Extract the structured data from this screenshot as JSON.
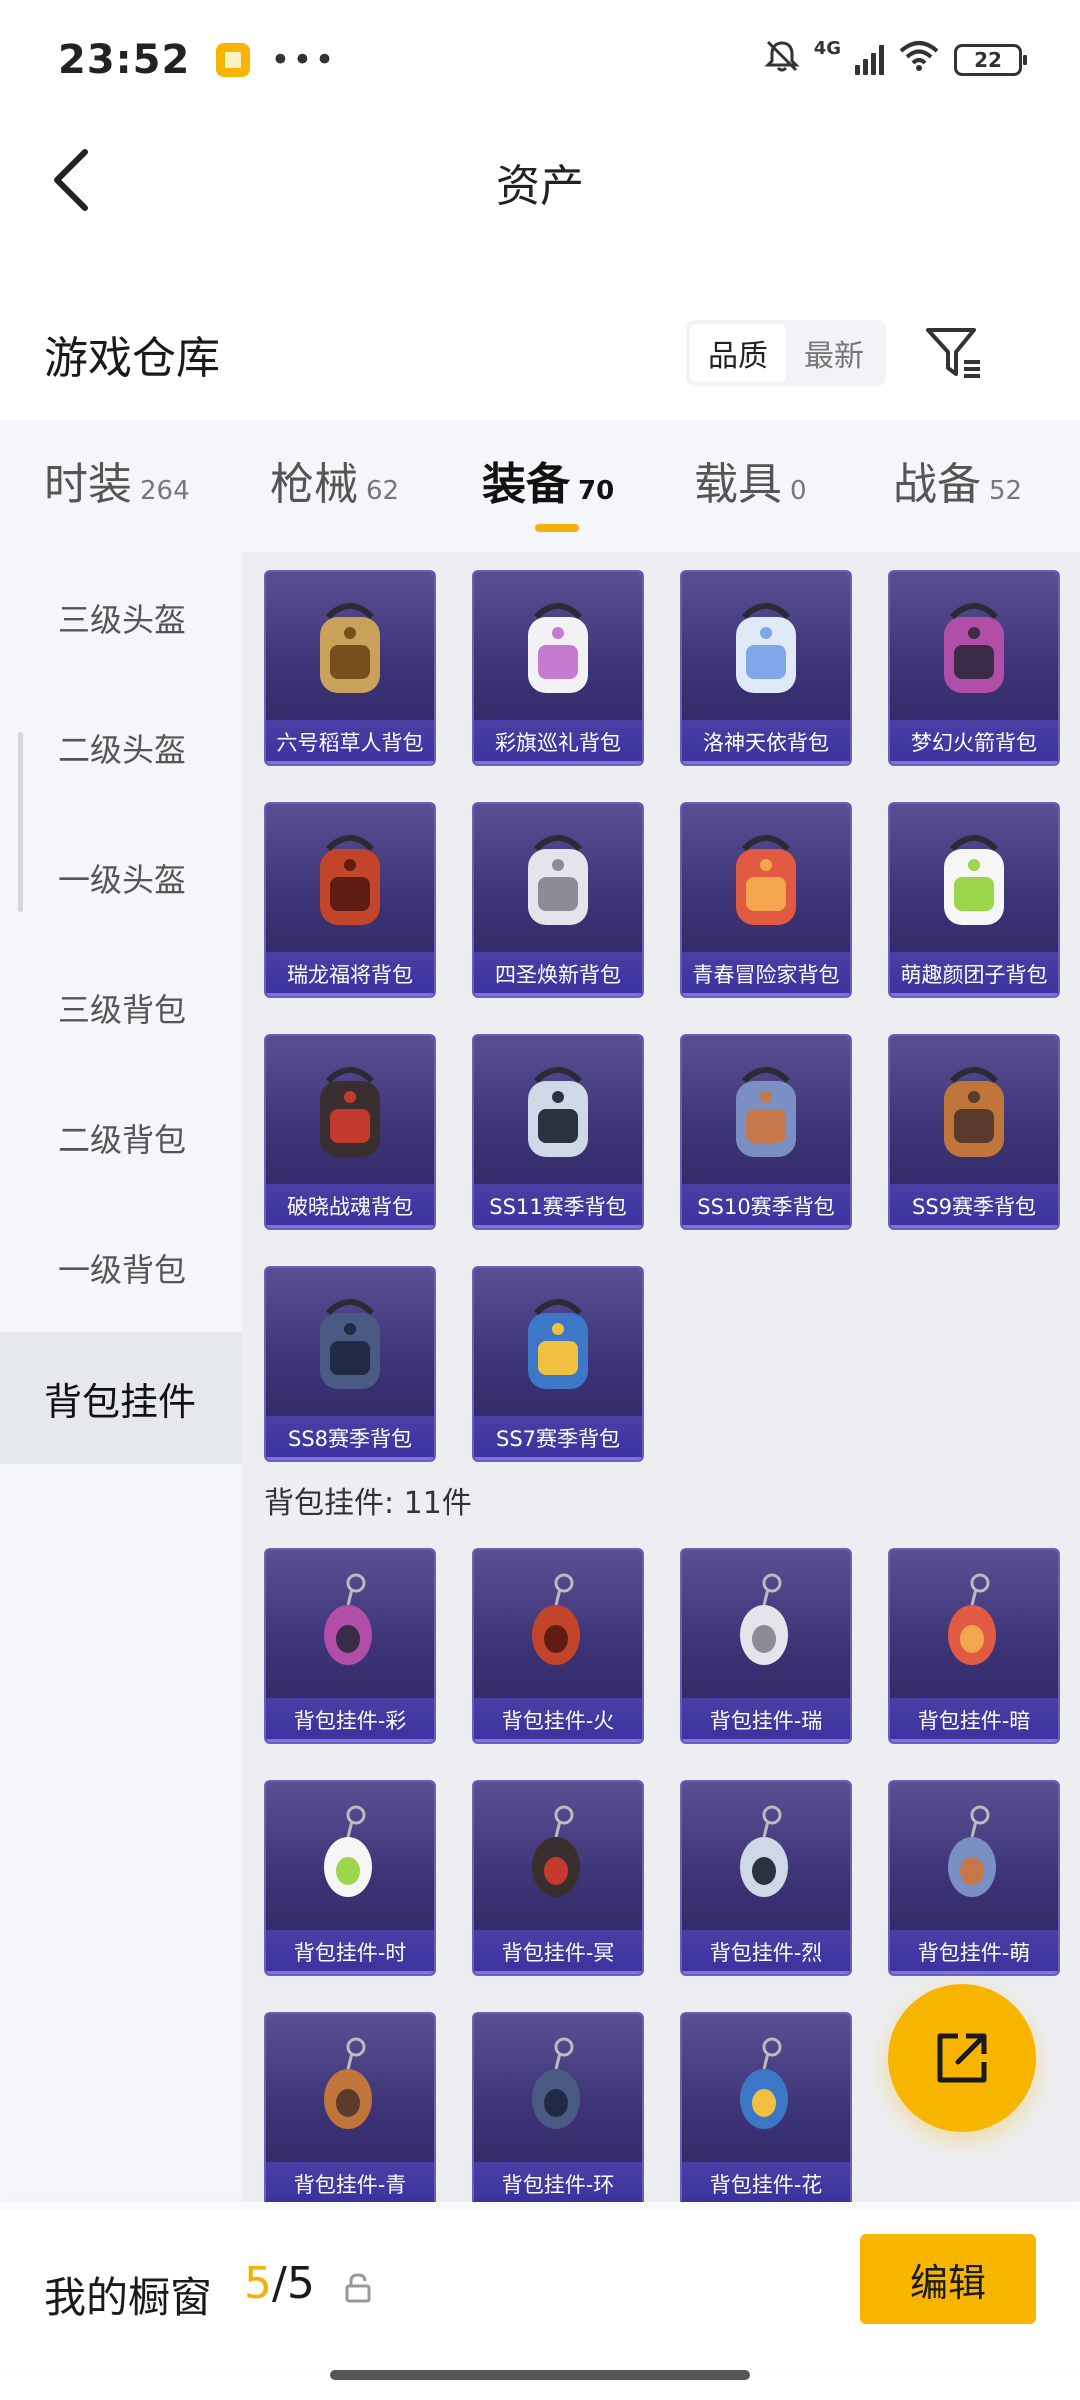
{
  "status_bar": {
    "time": "23:52",
    "dots": "•••",
    "network": "4G",
    "wifi_sub": "6",
    "battery": "22"
  },
  "header": {
    "title": "资产"
  },
  "section": {
    "title": "游戏仓库",
    "sort_options": [
      "品质",
      "最新"
    ],
    "active_sort": "品质"
  },
  "tabs": [
    {
      "label": "时装",
      "count": "264"
    },
    {
      "label": "枪械",
      "count": "62"
    },
    {
      "label": "装备",
      "count": "70",
      "active": true
    },
    {
      "label": "载具",
      "count": "0"
    },
    {
      "label": "战备",
      "count": "52"
    }
  ],
  "sidebar": {
    "items": [
      "三级头盔",
      "二级头盔",
      "一级头盔",
      "三级背包",
      "二级背包",
      "一级背包",
      "背包挂件"
    ],
    "active": "背包挂件"
  },
  "backpacks": [
    {
      "name": "六号稻草人背包",
      "icon": "scarecrow-backpack"
    },
    {
      "name": "彩旗巡礼背包",
      "icon": "parade-backpack"
    },
    {
      "name": "洛神天依背包",
      "icon": "tianyi-backpack"
    },
    {
      "name": "梦幻火箭背包",
      "icon": "rocket-backpack"
    },
    {
      "name": "瑞龙福将背包",
      "icon": "dragon-backpack"
    },
    {
      "name": "四圣焕新背包",
      "icon": "mecha-backpack"
    },
    {
      "name": "青春冒险家背包",
      "icon": "adventurer-backpack"
    },
    {
      "name": "萌趣颜团子背包",
      "icon": "dumpling-backpack"
    },
    {
      "name": "破晓战魂背包",
      "icon": "dawn-backpack"
    },
    {
      "name": "SS11赛季背包",
      "icon": "ss11-backpack"
    },
    {
      "name": "SS10赛季背包",
      "icon": "ss10-backpack"
    },
    {
      "name": "SS9赛季背包",
      "icon": "ss9-backpack"
    },
    {
      "name": "SS8赛季背包",
      "icon": "ss8-backpack"
    },
    {
      "name": "SS7赛季背包",
      "icon": "ss7-backpack"
    }
  ],
  "pendants_group": {
    "heading": "背包挂件: 11件"
  },
  "pendants": [
    {
      "name": "背包挂件-彩",
      "icon": "icecream-charm"
    },
    {
      "name": "背包挂件-火",
      "icon": "rocket-charm"
    },
    {
      "name": "背包挂件-瑞",
      "icon": "key-charm"
    },
    {
      "name": "背包挂件-暗",
      "icon": "bunny-charm"
    },
    {
      "name": "背包挂件-时",
      "icon": "crown-charm"
    },
    {
      "name": "背包挂件-冥",
      "icon": "pharaoh-charm"
    },
    {
      "name": "背包挂件-烈",
      "icon": "lion-charm"
    },
    {
      "name": "背包挂件-萌",
      "icon": "ufo-charm"
    },
    {
      "name": "背包挂件-青",
      "icon": "dino-charm"
    },
    {
      "name": "背包挂件-环",
      "icon": "ring-charm"
    },
    {
      "name": "背包挂件-花",
      "icon": "omamori-charm"
    }
  ],
  "bottom": {
    "showcase_label": "我的橱窗",
    "current": "5",
    "total": "/5",
    "edit_label": "编辑"
  },
  "colors": {
    "accent": "#f7b500",
    "card_bg": "#3d3477",
    "card_label": "#3b32a0"
  }
}
